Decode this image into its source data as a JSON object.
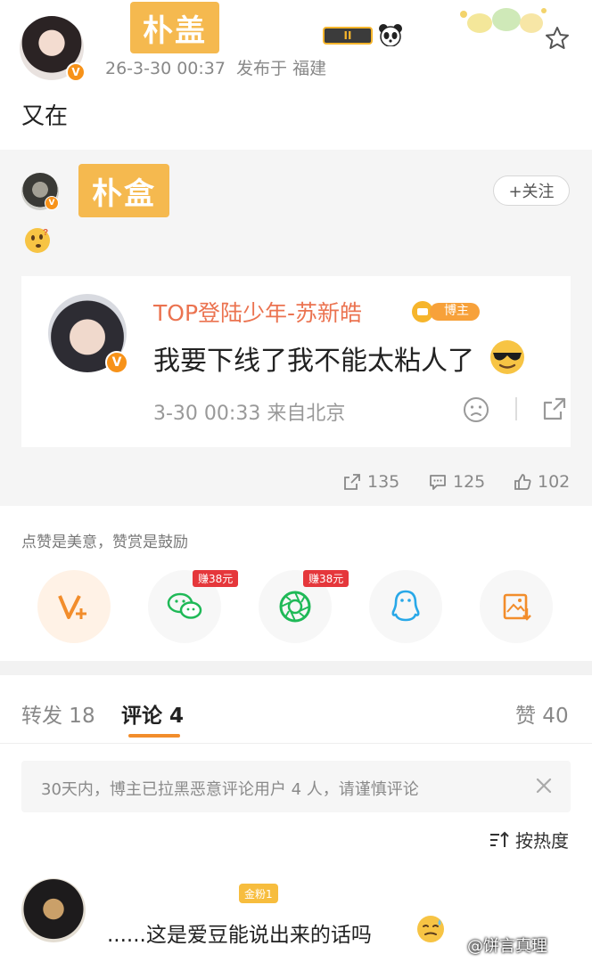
{
  "post": {
    "name_sticker": "朴盖",
    "date": "26-3-30 00:37",
    "location": "发布于 福建",
    "text": "又在",
    "medal": "II"
  },
  "retweeter": {
    "name_sticker": "朴盒",
    "follow_label": "+关注"
  },
  "card": {
    "author": "TOP登陆少年-苏新皓",
    "tag": "博主",
    "text": "我要下线了我不能太粘人了",
    "meta": "3-30 00:33 来自北京"
  },
  "stats": {
    "reposts": "135",
    "comments": "125",
    "likes": "102"
  },
  "reward": {
    "caption": "点赞是美意，赞赏是鼓励",
    "badge": "赚38元"
  },
  "tabs": {
    "repost": "转发 18",
    "comment": "评论 4",
    "like": "赞 40"
  },
  "notice": {
    "text": "30天内，博主已拉黑恶意评论用户 4 人，请谨慎评论"
  },
  "sort": {
    "label": "按热度"
  },
  "comment": {
    "badge": "金粉1",
    "text": "......这是爱豆能说出来的话吗"
  },
  "watermark": "@饼言真理",
  "colors": {
    "accent_orange": "#eb7350",
    "sticker": "#f5b94f",
    "wechat_green": "#1fb957",
    "qq_blue": "#28a8e8",
    "badge_red": "#e5373b"
  }
}
